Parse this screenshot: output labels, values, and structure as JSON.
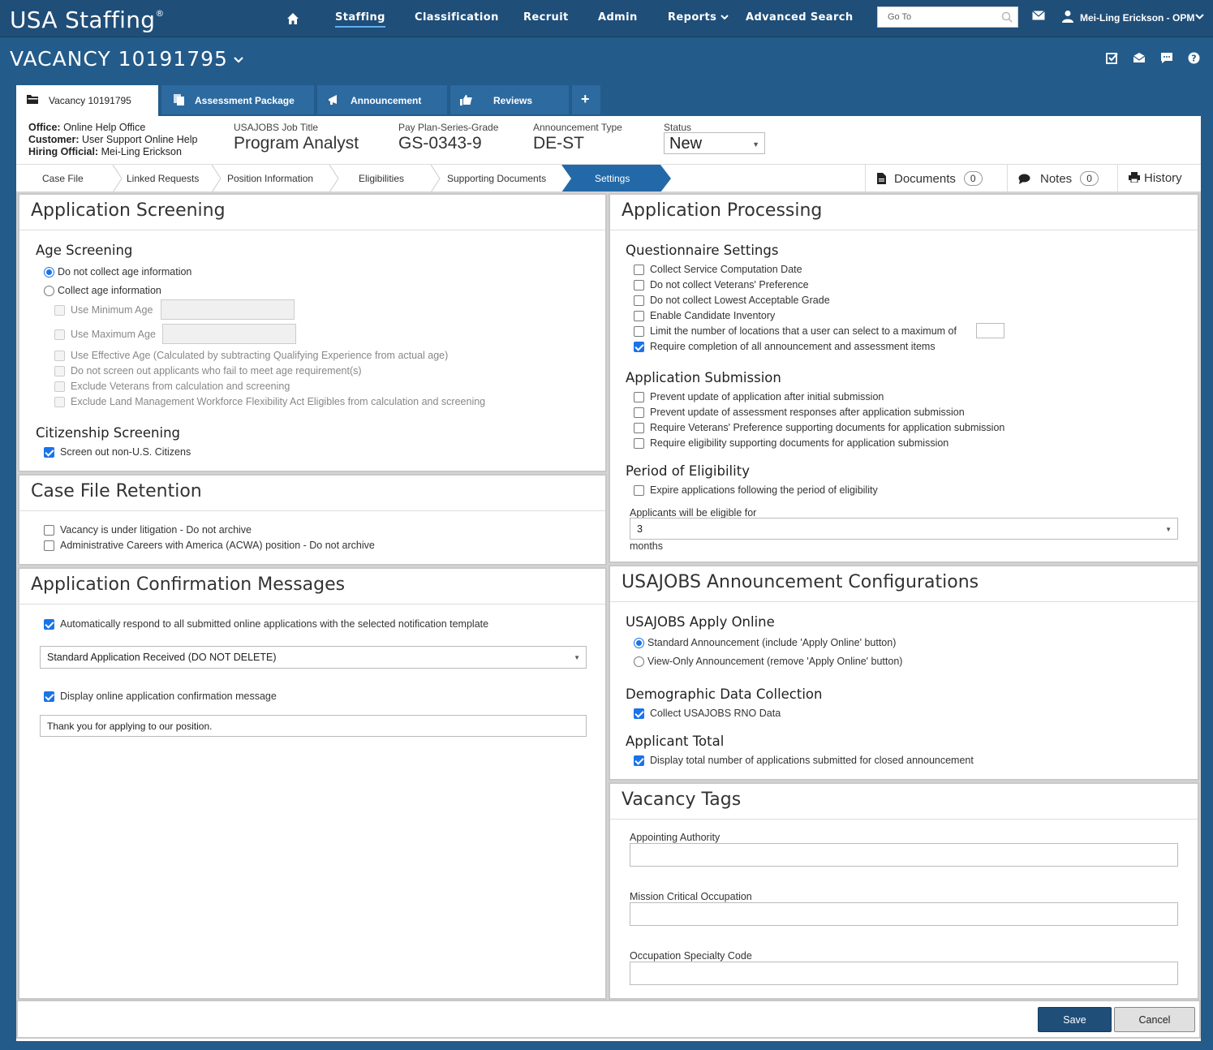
{
  "app": {
    "logo": "USA Staffing",
    "logo_mark": "®"
  },
  "nav": {
    "staffing": "Staffing",
    "classification": "Classification",
    "recruit": "Recruit",
    "admin": "Admin",
    "reports": "Reports",
    "advanced_search": "Advanced Search",
    "goto_placeholder": "Go To",
    "user": "Mei-Ling Erickson - OPM"
  },
  "vacancy": {
    "title": "VACANCY 10191795"
  },
  "tabs": {
    "vacancy": "Vacancy 10191795",
    "assessment": "Assessment Package",
    "announcement": "Announcement",
    "reviews": "Reviews",
    "add": "+"
  },
  "info": {
    "office_label": "Office:",
    "office": "Online Help Office",
    "customer_label": "Customer:",
    "customer": "User Support Online Help",
    "hiring_label": "Hiring Official:",
    "hiring": "Mei-Ling Erickson",
    "job_title_label": "USAJOBS Job Title",
    "job_title": "Program Analyst",
    "ppsg_label": "Pay Plan-Series-Grade",
    "ppsg": "GS-0343-9",
    "ann_type_label": "Announcement Type",
    "ann_type": "DE-ST",
    "status_label": "Status",
    "status": "New"
  },
  "crumbs": {
    "case_file": "Case File",
    "linked": "Linked Requests",
    "position": "Position Information",
    "elig": "Eligibilities",
    "docs": "Supporting Documents",
    "settings": "Settings"
  },
  "right_tabs": {
    "documents": "Documents",
    "documents_count": "0",
    "notes": "Notes",
    "notes_count": "0",
    "history": "History"
  },
  "screening": {
    "title": "Application Screening",
    "age_heading": "Age Screening",
    "no_collect": "Do not collect age information",
    "collect": "Collect age information",
    "min_age": "Use Minimum Age",
    "max_age": "Use Maximum Age",
    "effective": "Use Effective Age (Calculated by subtracting Qualifying Experience from actual age)",
    "no_screen": "Do not screen out applicants who fail to meet age requirement(s)",
    "exclude_vets": "Exclude Veterans from calculation and screening",
    "exclude_lmwfa": "Exclude Land Management Workforce Flexibility Act Eligibles from calculation and screening",
    "cit_heading": "Citizenship Screening",
    "screen_out": "Screen out non-U.S. Citizens"
  },
  "retention": {
    "title": "Case File Retention",
    "litigation": "Vacancy is under litigation - Do not archive",
    "acwa": "Administrative Careers with America (ACWA) position - Do not archive"
  },
  "confirm": {
    "title": "Application Confirmation Messages",
    "auto": "Automatically respond to all submitted online applications with the selected notification template",
    "template": "Standard Application Received (DO NOT DELETE)",
    "display": "Display online application confirmation message",
    "message": "Thank you for applying to our position."
  },
  "processing": {
    "title": "Application Processing",
    "q_heading": "Questionnaire Settings",
    "q1": "Collect Service Computation Date",
    "q2": "Do not collect Veterans' Preference",
    "q3": "Do not collect Lowest Acceptable Grade",
    "q4": "Enable Candidate Inventory",
    "q5": "Limit the number of locations that a user can select to a maximum of",
    "q6": "Require completion of all announcement and assessment items",
    "s_heading": "Application Submission",
    "s1": "Prevent update of application after initial submission",
    "s2": "Prevent update of assessment responses after application submission",
    "s3": "Require Veterans' Preference supporting documents for application submission",
    "s4": "Require eligibility supporting documents for application submission",
    "p_heading": "Period of Eligibility",
    "p1": "Expire applications following the period of eligibility",
    "elig_label": "Applicants will be eligible for",
    "elig_value": "3",
    "months": "months"
  },
  "usajobs": {
    "title": "USAJOBS Announcement Configurations",
    "apply_heading": "USAJOBS Apply Online",
    "standard": "Standard Announcement (include 'Apply Online' button)",
    "view_only": "View-Only Announcement (remove 'Apply Online' button)",
    "demo_heading": "Demographic Data Collection",
    "rno": "Collect USAJOBS RNO Data",
    "total_heading": "Applicant Total",
    "total": "Display total number of applications submitted for closed announcement"
  },
  "tags": {
    "title": "Vacancy Tags",
    "appointing": "Appointing Authority",
    "mco": "Mission Critical Occupation",
    "osc": "Occupation Specialty Code"
  },
  "footer": {
    "save": "Save",
    "cancel": "Cancel"
  }
}
